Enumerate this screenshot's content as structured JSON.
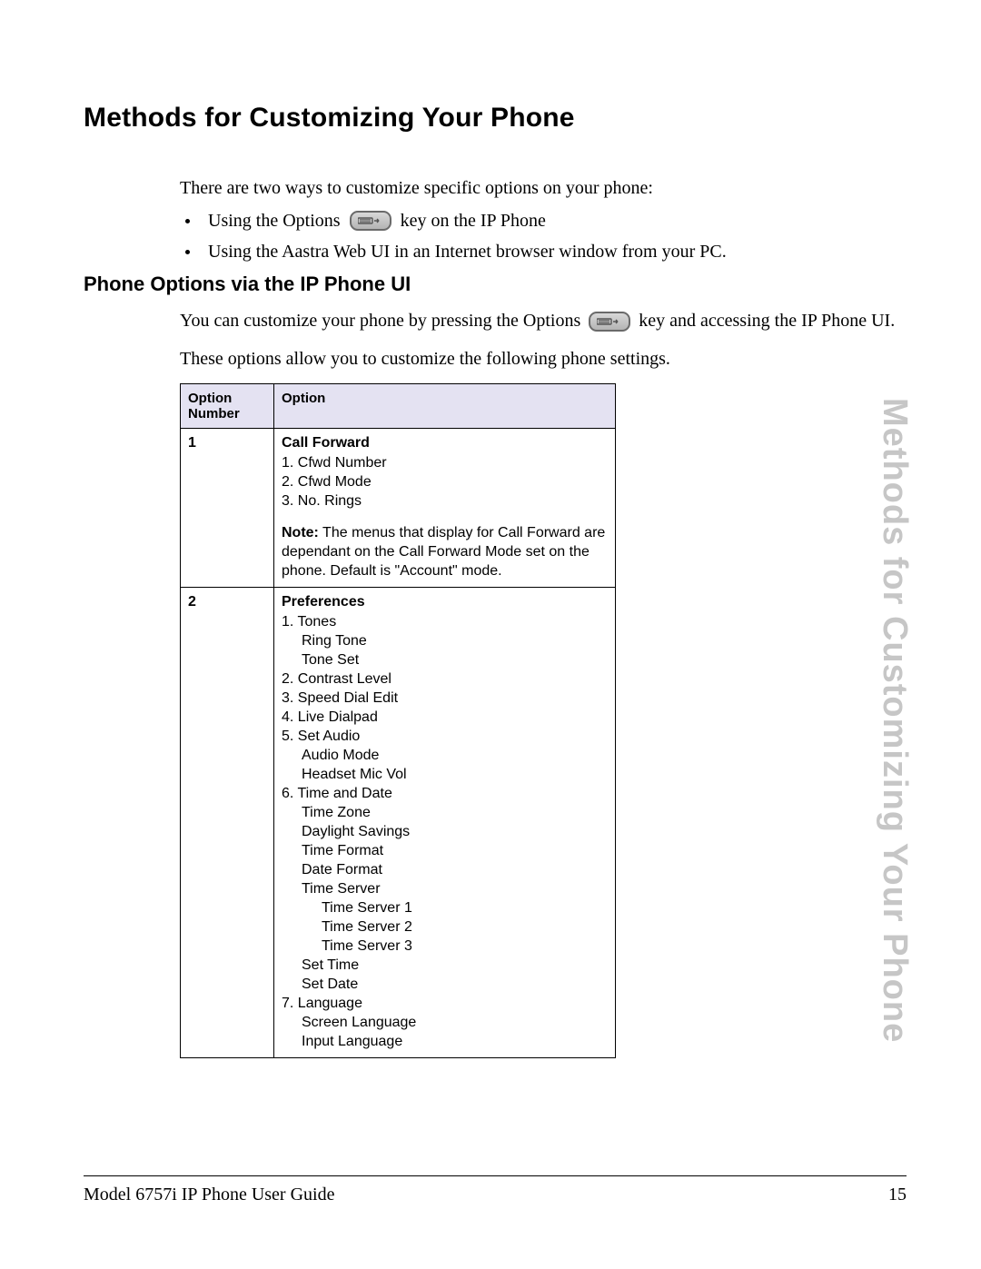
{
  "page_title": "Methods for Customizing Your Phone",
  "intro": {
    "lead": "There are two ways to customize specific options on your phone:",
    "bullet1_pre": "Using the Options",
    "bullet1_post": "key on the IP Phone",
    "bullet2": "Using the Aastra Web UI in an Internet browser window from your PC."
  },
  "section1": {
    "heading": "Phone Options via the IP Phone UI",
    "p1_pre": "You can customize your phone by pressing the Options",
    "p1_post": "key and accessing the IP Phone UI.",
    "p2": "These options allow you to customize the following phone settings."
  },
  "table": {
    "headers": {
      "num": "Option Number",
      "opt": "Option"
    },
    "row1": {
      "number": "1",
      "title": "Call Forward",
      "items": [
        "1. Cfwd Number",
        "2. Cfwd Mode",
        "3. No. Rings"
      ],
      "note_label": "Note:",
      "note_text": "The menus that display for Call Forward are dependant on the Call Forward Mode set on the phone. Default is \"Account\" mode."
    },
    "row2": {
      "number": "2",
      "title": "Preferences",
      "i1": "1. Tones",
      "i1a": "Ring Tone",
      "i1b": "Tone Set",
      "i2": "2. Contrast Level",
      "i3": "3. Speed Dial Edit",
      "i4": "4. Live Dialpad",
      "i5": "5. Set Audio",
      "i5a": "Audio Mode",
      "i5b": "Headset Mic Vol",
      "i6": "6. Time and Date",
      "i6a": "Time Zone",
      "i6b": "Daylight Savings",
      "i6c": "Time Format",
      "i6d": "Date Format",
      "i6e": "Time Server",
      "i6e1": "Time Server 1",
      "i6e2": "Time Server 2",
      "i6e3": "Time Server 3",
      "i6f": "Set Time",
      "i6g": "Set Date",
      "i7": "7. Language",
      "i7a": "Screen Language",
      "i7b": "Input Language"
    }
  },
  "side_tab": "Methods for Customizing Your Phone",
  "footer": {
    "left": "Model 6757i IP Phone User Guide",
    "right": "15"
  }
}
